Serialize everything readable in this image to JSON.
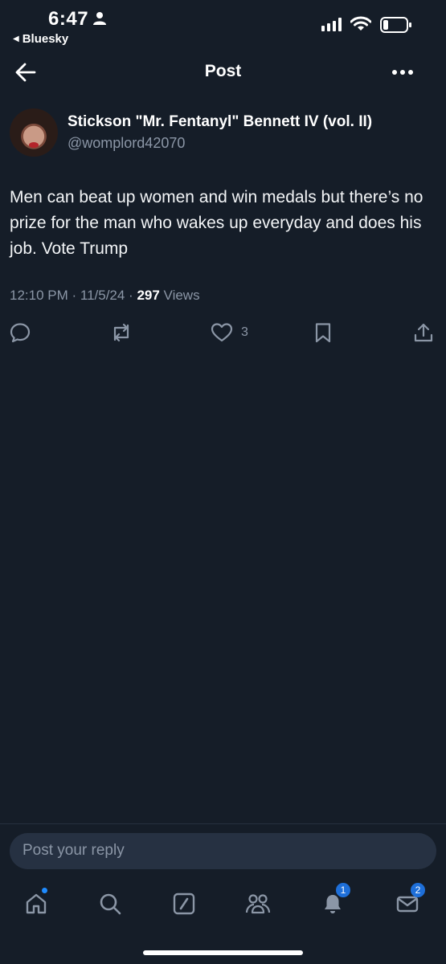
{
  "status_bar": {
    "time": "6:47",
    "back_app": "Bluesky"
  },
  "nav": {
    "title": "Post"
  },
  "post": {
    "display_name": "Stickson \"Mr. Fentanyl\" Bennett IV (vol. II)",
    "handle": "@womplord42070",
    "text": "Men can beat up women and win medals but there’s no prize for the man who wakes up everyday and does his job. Vote Trump",
    "timestamp": "12:10 PM · 11/5/24 · ",
    "views_count": "297",
    "views_label": " Views",
    "like_count": "3"
  },
  "composer": {
    "placeholder": "Post your reply"
  },
  "tabbar": {
    "notifications_badge": "1",
    "messages_badge": "2"
  },
  "colors": {
    "background": "#151d28",
    "muted_text": "#8b96a6",
    "badge": "#1e6fd9"
  }
}
